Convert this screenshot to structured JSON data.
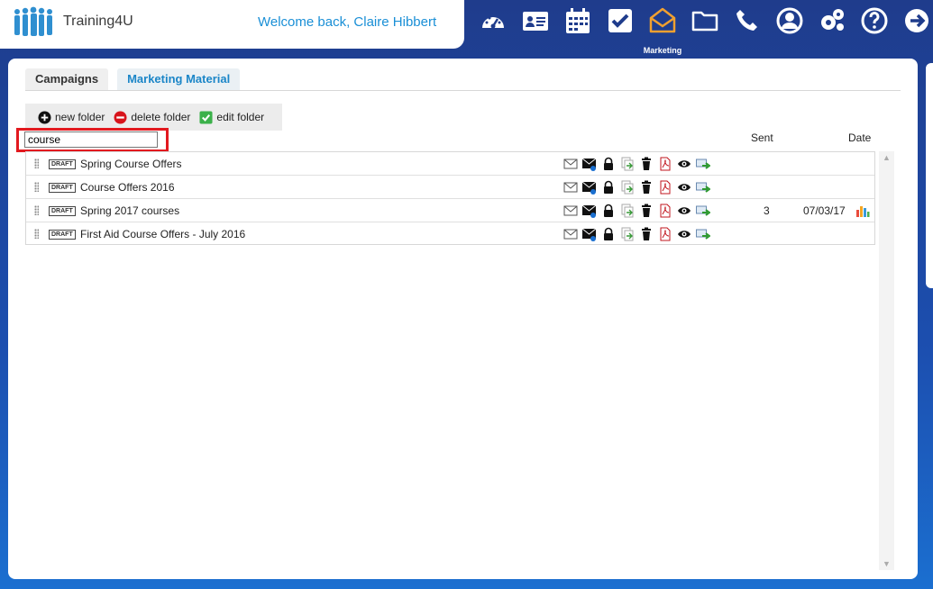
{
  "header": {
    "logo_text": "Training4U",
    "welcome": "Welcome back, Claire Hibbert",
    "active_nav_label": "Marketing"
  },
  "nav": [
    {
      "icon": "dashboard-icon"
    },
    {
      "icon": "contact-card-icon"
    },
    {
      "icon": "calendar-icon"
    },
    {
      "icon": "tasks-check-icon"
    },
    {
      "icon": "marketing-envelope-icon",
      "active": true
    },
    {
      "icon": "folder-icon"
    },
    {
      "icon": "phone-icon"
    },
    {
      "icon": "user-icon"
    },
    {
      "icon": "settings-icon"
    },
    {
      "icon": "help-icon"
    },
    {
      "icon": "logout-arrow-icon"
    }
  ],
  "tabs": [
    {
      "label": "Campaigns"
    },
    {
      "label": "Marketing Material"
    }
  ],
  "toolbar": {
    "new_folder": "new folder",
    "delete_folder": "delete folder",
    "edit_folder": "edit folder"
  },
  "search": {
    "value": "course"
  },
  "columns": {
    "sent": "Sent",
    "date": "Date"
  },
  "rows": [
    {
      "status": "DRAFT",
      "title": "Spring Course Offers",
      "sent": "",
      "date": ""
    },
    {
      "status": "DRAFT",
      "title": "Course Offers 2016",
      "sent": "",
      "date": ""
    },
    {
      "status": "DRAFT",
      "title": "Spring 2017 courses",
      "sent": "3",
      "date": "07/03/17"
    },
    {
      "status": "DRAFT",
      "title": "First Aid Course Offers - July 2016",
      "sent": "",
      "date": ""
    }
  ],
  "colors": {
    "accent": "#1b86c8",
    "nav_active": "#f0a030",
    "highlight": "#e2191f"
  }
}
